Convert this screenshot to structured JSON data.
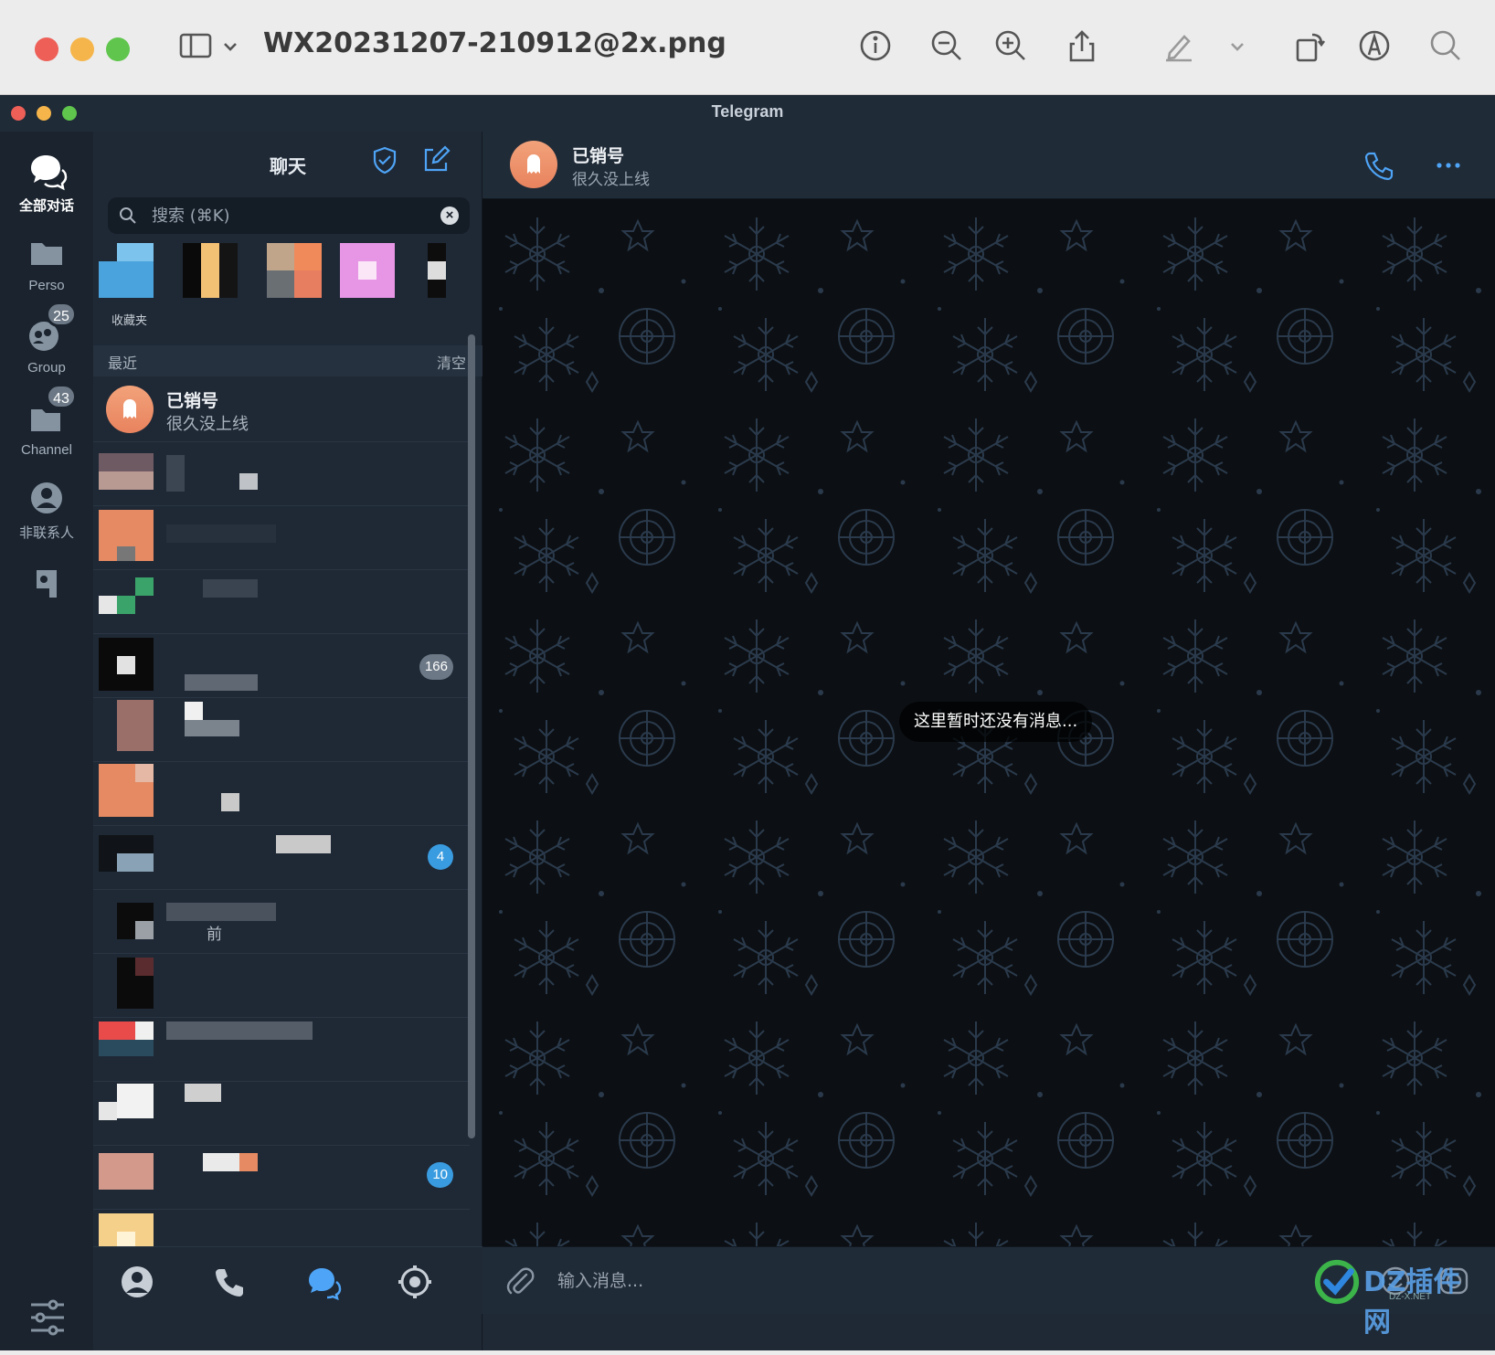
{
  "preview": {
    "file_title": "WX20231207-210912@2x.png",
    "toolbar_icons": [
      "sidebar-toggle-icon",
      "chevron-down-icon",
      "info-icon",
      "zoom-out-icon",
      "zoom-in-icon",
      "share-icon",
      "markup-pen-icon",
      "chevron-down-icon",
      "rotate-icon",
      "annotate-icon",
      "search-icon"
    ]
  },
  "window": {
    "title": "Telegram"
  },
  "rail": {
    "items": [
      {
        "label": "全部对话",
        "icon": "chat-bubbles-icon",
        "active": true
      },
      {
        "label": "Perso",
        "icon": "folder-icon"
      },
      {
        "label": "Group",
        "icon": "group-icon",
        "badge": "25"
      },
      {
        "label": "Channel",
        "icon": "channel-folder-icon",
        "badge": "43"
      },
      {
        "label": "非联系人",
        "icon": "person-icon"
      },
      {
        "label": "",
        "icon": "bot-icon"
      }
    ],
    "settings_icon": "sliders-icon"
  },
  "chat_list": {
    "header_title": "聊天",
    "search_placeholder": "搜索 (⌘K)",
    "story_label": "收藏夹",
    "section_label": "最近",
    "section_action": "清空",
    "top_chat": {
      "name": "已销号",
      "subtitle": "很久没上线"
    },
    "unread_badges": [
      "166",
      "4",
      "10"
    ],
    "blurred_fragments": [
      "前"
    ]
  },
  "footer_tabs": [
    "contacts-icon",
    "calls-icon",
    "chats-icon",
    "settings-icon"
  ],
  "chat": {
    "name": "已销号",
    "status": "很久没上线",
    "empty_text": "这里暂时还没有消息...",
    "input_placeholder": "输入消息..."
  },
  "watermark": {
    "text": "DZ插件网",
    "sub": "DZ-X.NET"
  },
  "colors": {
    "accent": "#4ea4f6",
    "avatar_deleted": "#ec8c66",
    "badge_muted": "#6c7885",
    "badge_active": "#3a9ce0"
  }
}
